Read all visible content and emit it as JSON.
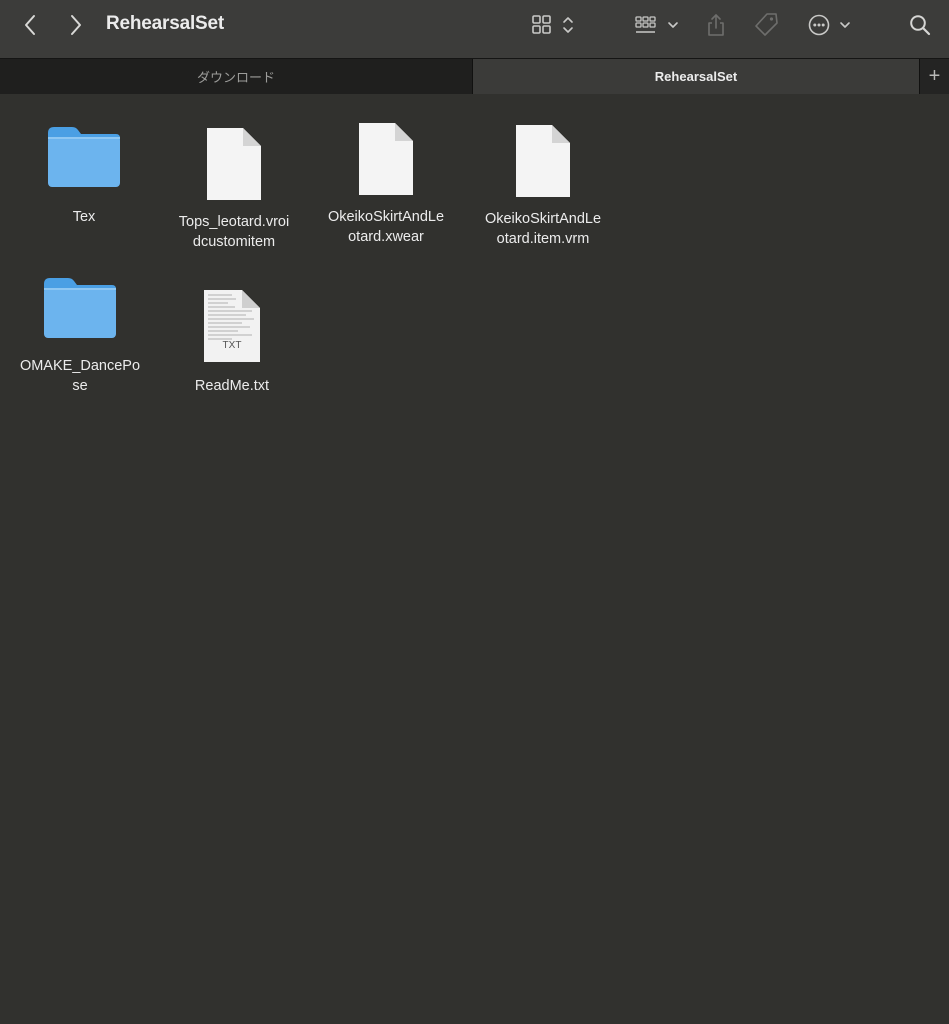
{
  "window": {
    "title": "RehearsalSet"
  },
  "toolbar": {
    "back_icon": "chevron-left-icon",
    "forward_icon": "chevron-right-icon",
    "view_icon": "icon-grid-view-icon",
    "group_icon": "group-list-icon",
    "share_icon": "share-icon",
    "tag_icon": "tag-icon",
    "more_icon": "ellipsis-circle-icon",
    "search_icon": "search-icon"
  },
  "tabs": [
    {
      "label": "ダウンロード",
      "active": false
    },
    {
      "label": "RehearsalSet",
      "active": true
    }
  ],
  "tab_add_label": "+",
  "items": [
    {
      "name": "Tex",
      "kind": "folder"
    },
    {
      "name": "Tops_leotard.vroi\ndcustomitem",
      "kind": "file"
    },
    {
      "name": "OkeikoSkirtAndLe\notard.xwear",
      "kind": "file"
    },
    {
      "name": "OkeikoSkirtAndLe\notard.item.vrm",
      "kind": "file"
    },
    {
      "name": "OMAKE_DancePo\nse",
      "kind": "folder"
    },
    {
      "name": "ReadMe.txt",
      "kind": "text-file",
      "badge": "TXT"
    }
  ],
  "colors": {
    "window_bg": "#31312e",
    "toolbar_bg": "#3c3c3a",
    "tabbar_bg": "#1f1f1e",
    "folder_blue": "#6cb4ee"
  }
}
